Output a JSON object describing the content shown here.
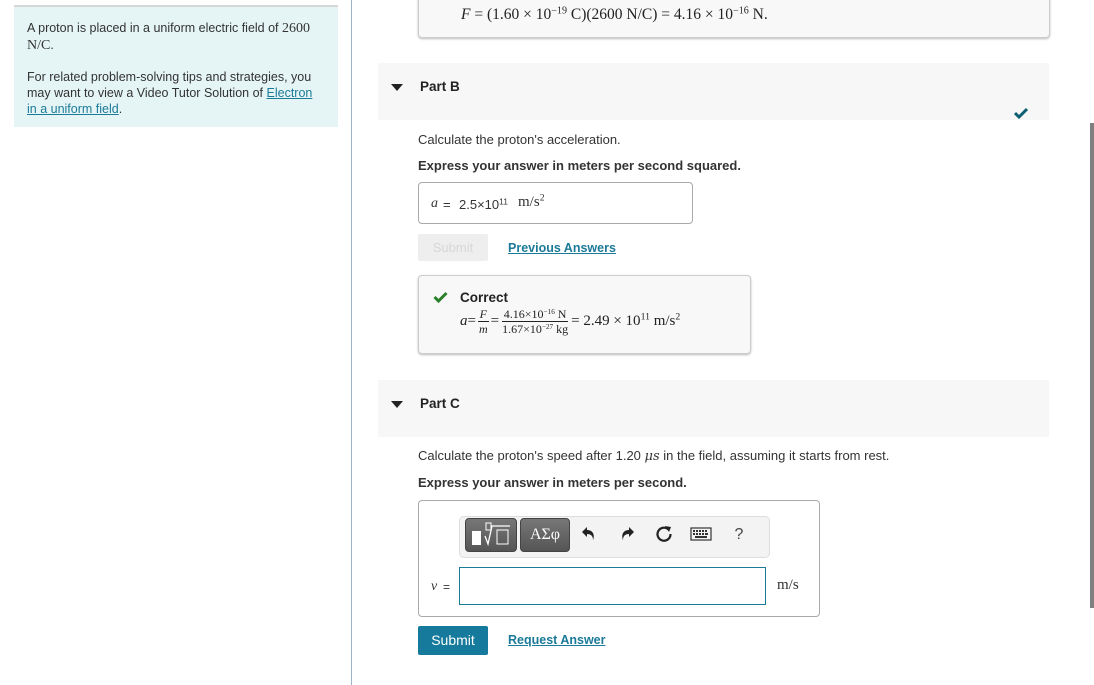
{
  "intro": {
    "line1": "A proton is placed in a uniform electric field of",
    "field_value": "2600 N/C",
    "line1_end": ".",
    "tips_text": "For related problem-solving tips and strategies, you may want to view a Video Tutor Solution of",
    "tips_link": "Electron in a uniform field",
    "tips_end": "."
  },
  "partA_feedback": {
    "F": "F",
    "eq1": " = (1.60 × 10",
    "exp1": "−19",
    "mid": " C)(2600 N/C) = 4.16 × 10",
    "exp2": "−16",
    "end": " N."
  },
  "partB": {
    "label": "Part B",
    "status": "completed",
    "prompt": "Calculate the proton's acceleration.",
    "instruction": "Express your answer in meters per second squared.",
    "answer_var": "a",
    "answer_eq": "=",
    "answer_value_mantissa": "2.5×10",
    "answer_value_exp": "11",
    "answer_unit": "m/s",
    "answer_unit_exp": "2",
    "submit_label": "Submit",
    "submit_enabled": false,
    "previous_answers_label": "Previous Answers",
    "feedback": {
      "title": "Correct",
      "a": "a",
      "eq": " =",
      "frac1_num": "F",
      "frac1_den": "m",
      "frac2_num_m": "4.16×10",
      "frac2_num_exp": "−16",
      "frac2_num_unit": " N",
      "frac2_den_m": "1.67×10",
      "frac2_den_exp": "−27",
      "frac2_den_unit": " kg",
      "result": "= 2.49 × 10",
      "result_exp": "11",
      "result_unit": " m/s",
      "result_unit_exp": "2"
    }
  },
  "partC": {
    "label": "Part C",
    "prompt_before": "Calculate the proton's speed after 1.20 ",
    "prompt_unit": "μs",
    "prompt_after": " in the field, assuming it starts from rest.",
    "instruction": "Express your answer in meters per second.",
    "toolbar": {
      "templates_icon": "templates-icon",
      "symbols_label": "ΑΣφ",
      "undo_icon": "undo-icon",
      "redo_icon": "redo-icon",
      "reset_icon": "reset-icon",
      "keyboard_icon": "keyboard-icon",
      "help_label": "?"
    },
    "answer_var": "v",
    "answer_eq": "=",
    "answer_value": "",
    "answer_unit": "m/s",
    "submit_label": "Submit",
    "request_answer_label": "Request Answer"
  },
  "colors": {
    "accent": "#157a9b",
    "link": "#1b7a98",
    "correct": "#2a7f2a",
    "intro_bg": "#e5f5f5"
  }
}
